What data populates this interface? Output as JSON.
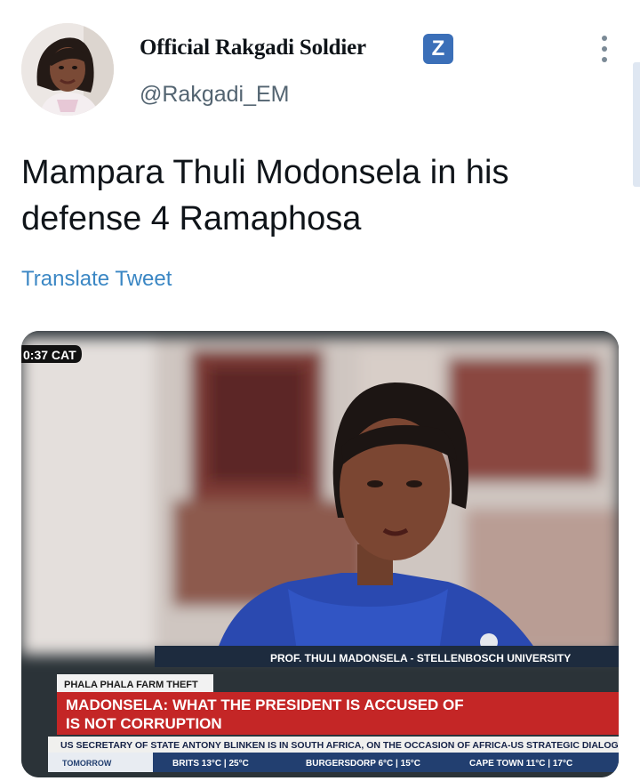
{
  "user": {
    "display_name": "Official Rakgadi Soldier",
    "badge": "Z",
    "handle": "@Rakgadi_EM"
  },
  "tweet": {
    "text": "Mampara Thuli Modonsela in his defense 4 Ramaphosa",
    "translate_label": "Translate Tweet"
  },
  "media": {
    "clock": "0:37 CAT",
    "caption": "PROF. THULI MADONSELA - STELLENBOSCH UNIVERSITY",
    "topic_tag": "PHALA PHALA FARM THEFT",
    "headline_line1": "MADONSELA: WHAT THE PRESIDENT IS ACCUSED OF",
    "headline_line2": "IS NOT CORRUPTION",
    "ticker": "US SECRETARY OF STATE ANTONY BLINKEN IS IN SOUTH AFRICA, ON THE OCCASION OF AFRICA-US STRATEGIC DIALOGUE",
    "weather_label": "TOMORROW",
    "weather_1": "BRITS 13°C | 25°C",
    "weather_2": "BURGERSDORP 6°C | 15°C",
    "weather_3": "CAPE TOWN 11°C | 17°C"
  },
  "colors": {
    "badge_bg": "#3b6fb8",
    "link": "#3b87c4",
    "headline_red": "#c42626",
    "presenter_blue": "#2a49b0"
  }
}
